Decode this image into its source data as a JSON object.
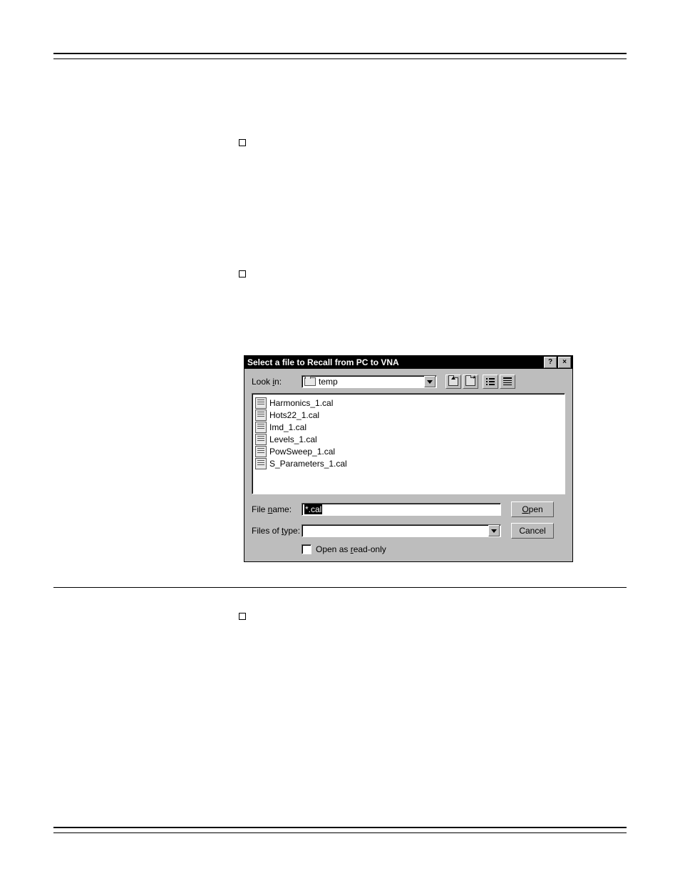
{
  "dialog": {
    "title": "Select a file to Recall from PC to VNA",
    "help_btn": "?",
    "close_btn": "×",
    "look_in_label": "Look in:",
    "look_in_value": "temp",
    "toolbar": {
      "up": "up-one-level",
      "new": "create-new-folder",
      "list": "list-view",
      "details": "details-view"
    },
    "files": [
      "Harmonics_1.cal",
      "Hots22_1.cal",
      "Imd_1.cal",
      "Levels_1.cal",
      "PowSweep_1.cal",
      "S_Parameters_1.cal"
    ],
    "file_name_label": "File name:",
    "file_name_value": "*.cal",
    "files_of_type_label": "Files of type:",
    "files_of_type_value": "",
    "open_label": "Open",
    "cancel_label": "Cancel",
    "readonly_label": "Open as read-only"
  }
}
